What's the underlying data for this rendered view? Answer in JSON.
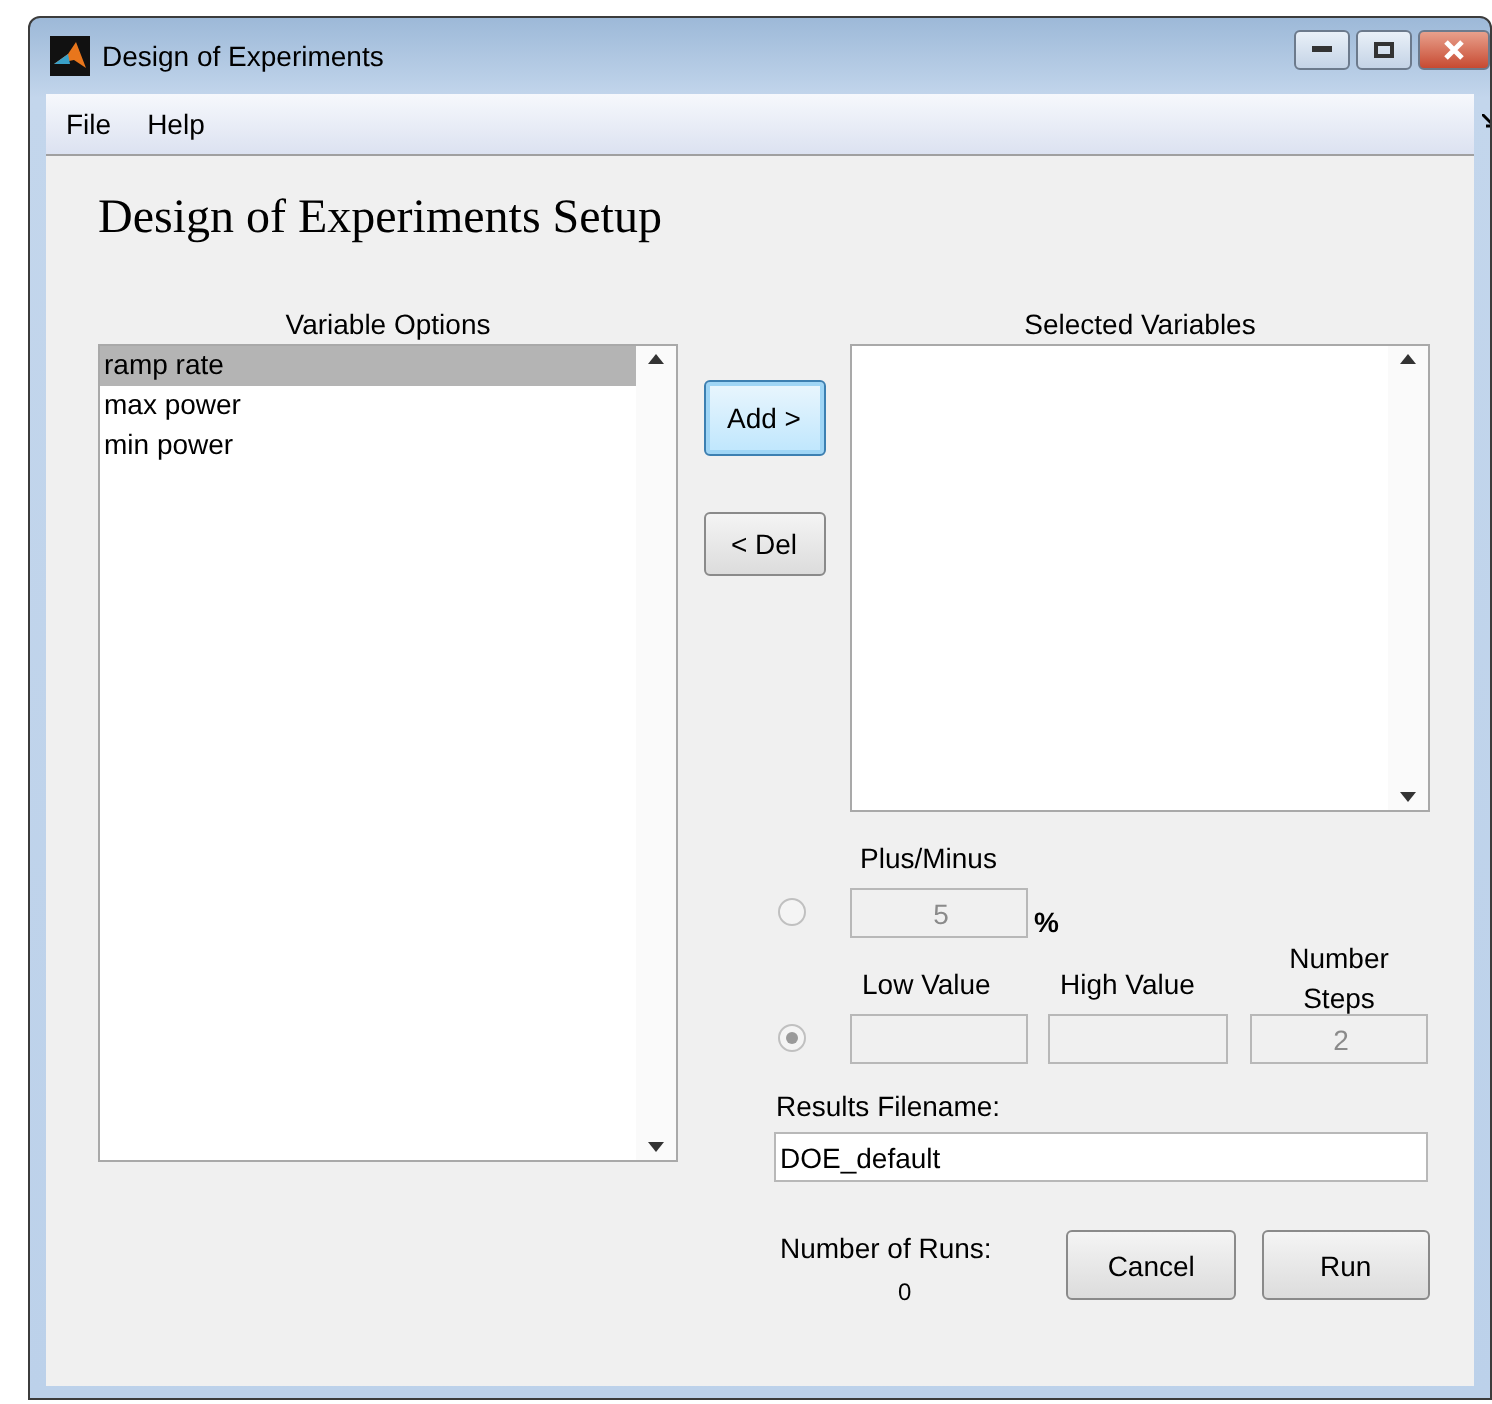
{
  "window": {
    "title": "Design of Experiments"
  },
  "menu": [
    "File",
    "Help"
  ],
  "heading": "Design of Experiments Setup",
  "variable_options": {
    "label": "Variable Options",
    "items": [
      {
        "label": "ramp rate",
        "selected": true
      },
      {
        "label": "max power",
        "selected": false
      },
      {
        "label": "min power",
        "selected": false
      }
    ]
  },
  "buttons": {
    "add": {
      "label": "Add >",
      "focused": true
    },
    "del": {
      "label": "< Del",
      "focused": false
    }
  },
  "selected_variables": {
    "label": "Selected Variables"
  },
  "plus_minus": {
    "label": "Plus/Minus",
    "selected": false,
    "disabled": true,
    "value": "5",
    "unit": "%"
  },
  "range": {
    "selected": true,
    "low_label": "Low Value",
    "high_label": "High Value",
    "steps_label": "Number Steps",
    "steps_value": "2"
  },
  "results_filename": {
    "label": "Results Filename:",
    "value": "DOE_default"
  },
  "number_of_runs": {
    "label": "Number of Runs:",
    "value": "0"
  },
  "actions": [
    "Cancel",
    "Run"
  ]
}
